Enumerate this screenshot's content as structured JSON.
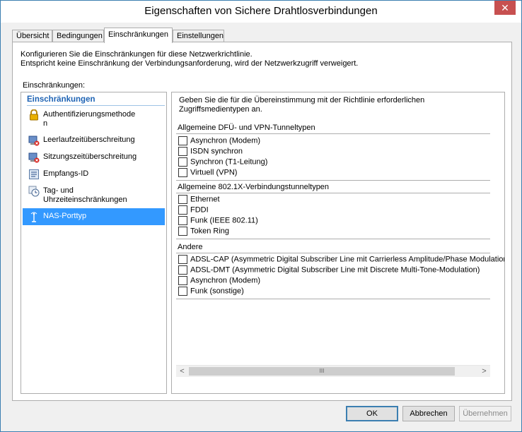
{
  "window": {
    "title": "Eigenschaften von Sichere Drahtlosverbindungen",
    "close_label": "✕"
  },
  "tabs": [
    {
      "label": "Übersicht"
    },
    {
      "label": "Bedingungen"
    },
    {
      "label": "Einschränkungen",
      "active": true
    },
    {
      "label": "Einstellungen"
    }
  ],
  "description": {
    "line1": "Konfigurieren Sie die Einschränkungen für diese Netzwerkrichtlinie.",
    "line2": "Entspricht keine Einschränkung der Verbindungsanforderung, wird der Netzwerkzugriff verweigert."
  },
  "restrictions_label": "Einschränkungen:",
  "nav": {
    "header": "Einschränkungen",
    "items": [
      {
        "label": "Authentifizierungsmethode\nn",
        "icon": "lock-icon"
      },
      {
        "label": "Leerlaufzeitüberschreitung",
        "icon": "idle-timeout-icon"
      },
      {
        "label": "Sitzungszeitüberschreitung",
        "icon": "session-timeout-icon"
      },
      {
        "label": "Empfangs-ID",
        "icon": "called-station-id-icon"
      },
      {
        "label": "Tag- und\nUhrzeiteinschränkungen",
        "icon": "clock-icon"
      },
      {
        "label": "NAS-Porttyp",
        "icon": "nas-port-icon",
        "selected": true
      }
    ]
  },
  "detail": {
    "intro_line1": "Geben Sie die für die Übereinstimmung mit der Richtlinie erforderlichen",
    "intro_line2": "Zugriffsmedientypen an.",
    "groups": [
      {
        "title": "Allgemeine DFÜ- und VPN-Tunneltypen",
        "options": [
          "Asynchron (Modem)",
          "ISDN synchron",
          "Synchron (T1-Leitung)",
          "Virtuell (VPN)"
        ]
      },
      {
        "title": "Allgemeine 802.1X-Verbindungstunneltypen",
        "options": [
          "Ethernet",
          "FDDI",
          "Funk (IEEE 802.11)",
          "Token Ring"
        ]
      },
      {
        "title": "Andere",
        "options": [
          "ADSL-CAP (Asymmetric Digital Subscriber Line mit Carrierless Amplitude/Phase Modulation",
          "ADSL-DMT (Asymmetric Digital Subscriber Line mit Discrete Multi-Tone-Modulation)",
          "Asynchron (Modem)",
          "Funk (sonstige)"
        ]
      }
    ]
  },
  "scrollbar": {
    "left_arrow": "<",
    "right_arrow": ">",
    "grip": "III"
  },
  "buttons": {
    "ok": "OK",
    "cancel": "Abbrechen",
    "apply": "Übernehmen"
  }
}
